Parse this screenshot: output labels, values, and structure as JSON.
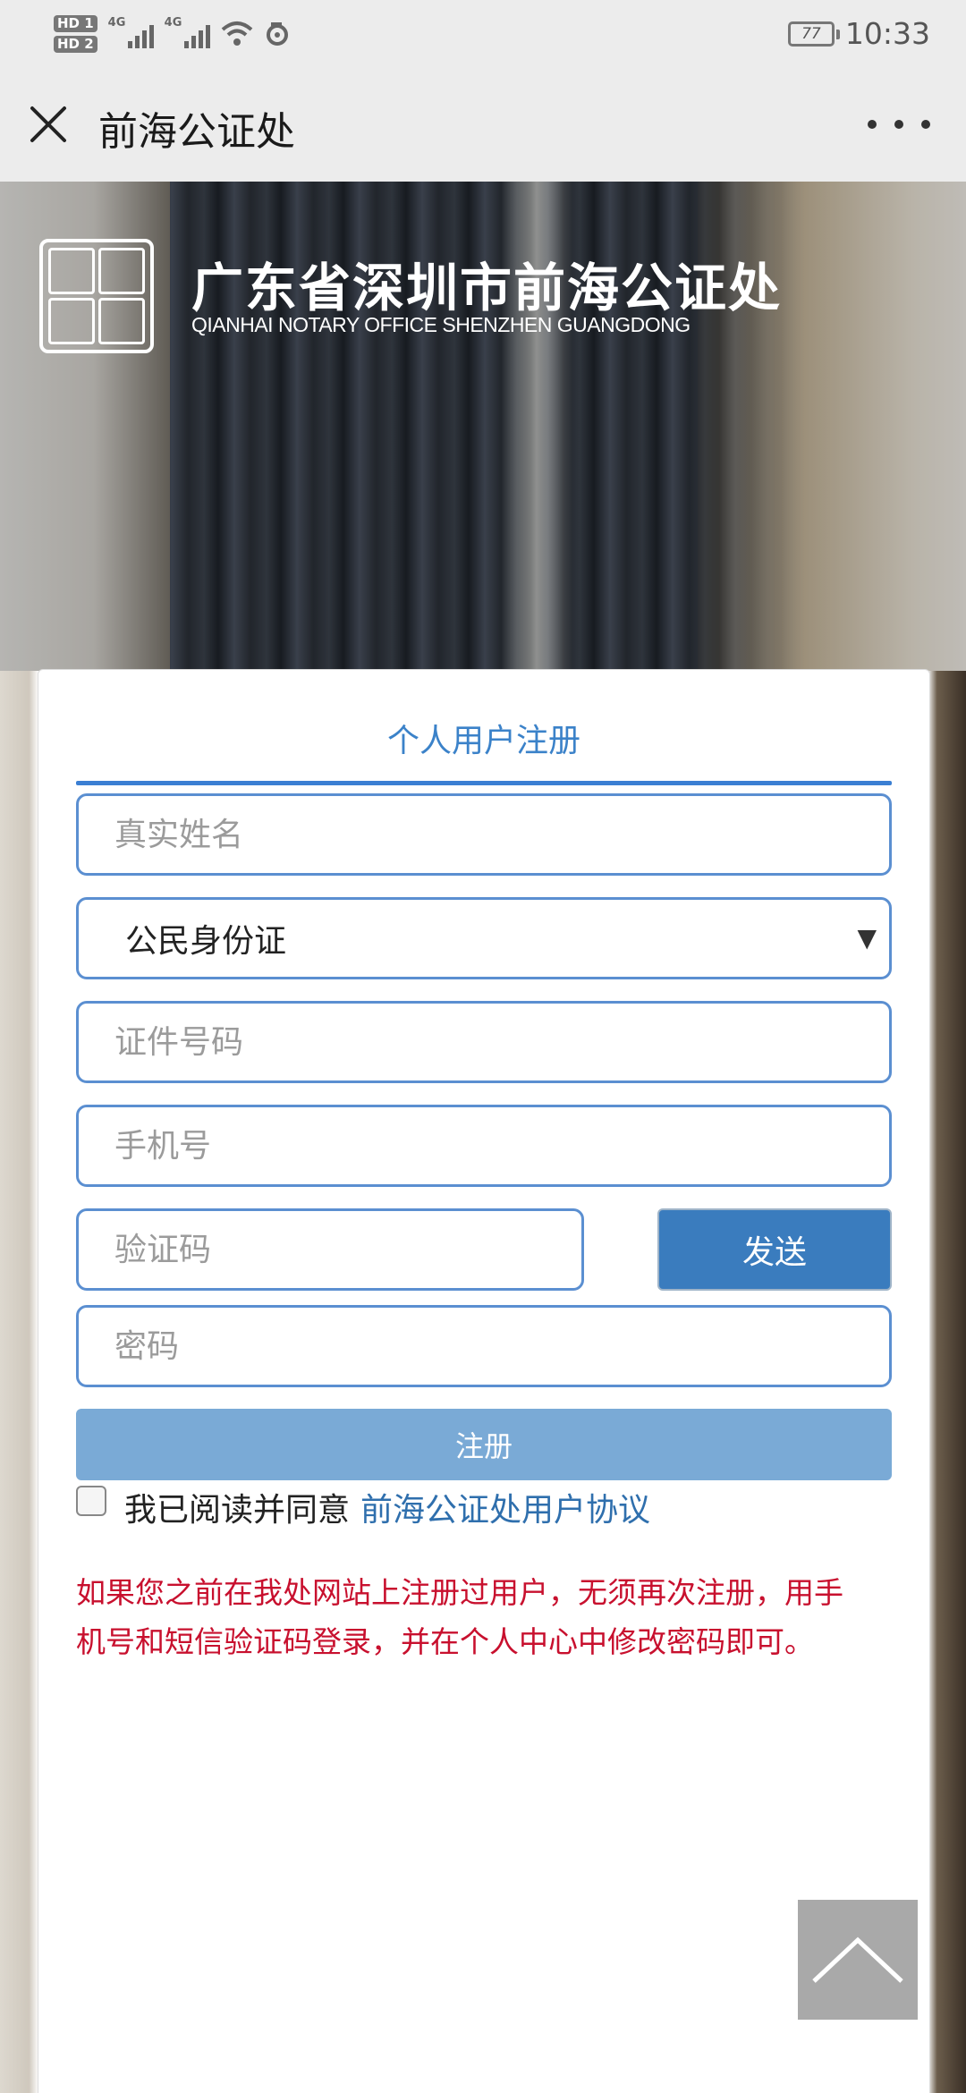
{
  "status_bar": {
    "hd1": "HD 1",
    "hd2": "HD 2",
    "net1": "4G",
    "net2": "4G",
    "battery": "77",
    "time": "10:33"
  },
  "nav": {
    "title": "前海公证处"
  },
  "banner": {
    "org_name": "广东省深圳市前海公证处",
    "org_name_en": "QIANHAI NOTARY OFFICE SHENZHEN GUANGDONG"
  },
  "form": {
    "title": "个人用户注册",
    "name_placeholder": "真实姓名",
    "id_type_selected": "公民身份证",
    "id_number_placeholder": "证件号码",
    "phone_placeholder": "手机号",
    "code_placeholder": "验证码",
    "send_label": "发送",
    "password_placeholder": "密码",
    "register_label": "注册",
    "agree_text": "我已阅读并同意",
    "agreement_link": "前海公证处用户协议",
    "notice": "如果您之前在我处网站上注册过用户，无须再次注册，用手机号和短信验证码登录，并在个人中心中修改密码即可。"
  },
  "colors": {
    "accent": "#3b7fd3",
    "send_button": "#3a7cbe",
    "register_button": "#7aaad6",
    "notice_text": "#c8102e"
  }
}
